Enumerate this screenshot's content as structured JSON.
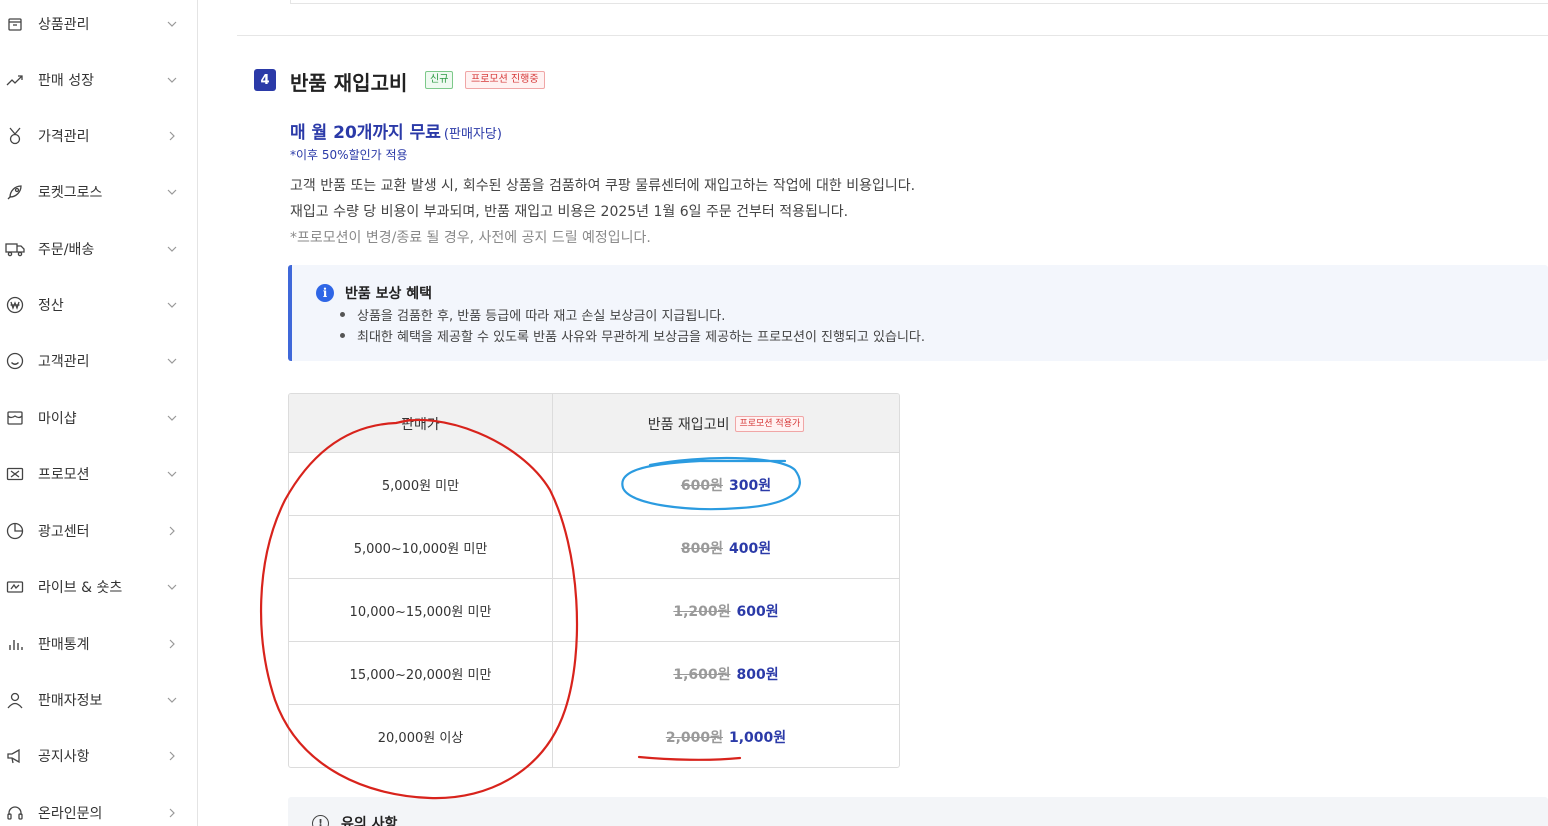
{
  "sidebar": {
    "items": [
      {
        "label": "상품관리",
        "icon": "box-icon",
        "chevron": "down"
      },
      {
        "label": "판매 성장",
        "icon": "trend-up-icon",
        "chevron": "down"
      },
      {
        "label": "가격관리",
        "icon": "medal-icon",
        "chevron": "right"
      },
      {
        "label": "로켓그로스",
        "icon": "rocket-icon",
        "chevron": "down"
      },
      {
        "label": "주문/배송",
        "icon": "truck-icon",
        "chevron": "down"
      },
      {
        "label": "정산",
        "icon": "won-icon",
        "chevron": "down"
      },
      {
        "label": "고객관리",
        "icon": "smile-icon",
        "chevron": "down"
      },
      {
        "label": "마이샵",
        "icon": "shop-icon",
        "chevron": "down"
      },
      {
        "label": "프로모션",
        "icon": "ticket-icon",
        "chevron": "down"
      },
      {
        "label": "광고센터",
        "icon": "pie-icon",
        "chevron": "right"
      },
      {
        "label": "라이브 & 숏츠",
        "icon": "live-icon",
        "chevron": "down"
      },
      {
        "label": "판매통계",
        "icon": "bar-chart-icon",
        "chevron": "right"
      },
      {
        "label": "판매자정보",
        "icon": "user-icon",
        "chevron": "down"
      },
      {
        "label": "공지사항",
        "icon": "megaphone-icon",
        "chevron": "right"
      },
      {
        "label": "온라인문의",
        "icon": "headset-icon",
        "chevron": "right"
      }
    ]
  },
  "section": {
    "number": "4",
    "title": "반품 재입고비",
    "badge_new": "신규",
    "badge_promo": "프로모션 진행중",
    "free_main": "매 월 20개까지 무료",
    "free_sub": "(판매자당)",
    "after_note": "*이후 50%할인가 적용",
    "desc1": "고객 반품 또는 교환 발생 시, 회수된 상품을 검품하여 쿠팡 물류센터에 재입고하는 작업에 대한 비용입니다.",
    "desc2": "재입고 수량 당 비용이 부과되며, 반품 재입고 비용은 2025년 1월 6일 주문 건부터 적용됩니다.",
    "desc3": "*프로모션이 변경/종료 될 경우, 사전에 공지 드릴 예정입니다."
  },
  "info": {
    "title": "반품 보상 혜택",
    "items": [
      "상품을 검품한 후, 반품 등급에 따라 재고 손실 보상금이 지급됩니다.",
      "최대한 혜택을 제공할 수 있도록 반품 사유와 무관하게 보상금을 제공하는 프로모션이 진행되고 있습니다."
    ]
  },
  "table": {
    "col1": "판매가",
    "col2": "반품 재입고비",
    "col2_badge": "프로모션 적용가",
    "rows": [
      {
        "range": "5,000원 미만",
        "old": "600원",
        "new": "300원"
      },
      {
        "range": "5,000~10,000원 미만",
        "old": "800원",
        "new": "400원"
      },
      {
        "range": "10,000~15,000원 미만",
        "old": "1,200원",
        "new": "600원"
      },
      {
        "range": "15,000~20,000원 미만",
        "old": "1,600원",
        "new": "800원"
      },
      {
        "range": "20,000원 이상",
        "old": "2,000원",
        "new": "1,000원"
      }
    ]
  },
  "caution": {
    "title": "유의 사항"
  },
  "colors": {
    "accent": "#2b3aa8",
    "info_border": "#3f68d9",
    "annotation_red": "#d8231c",
    "annotation_blue": "#2b9be0"
  }
}
